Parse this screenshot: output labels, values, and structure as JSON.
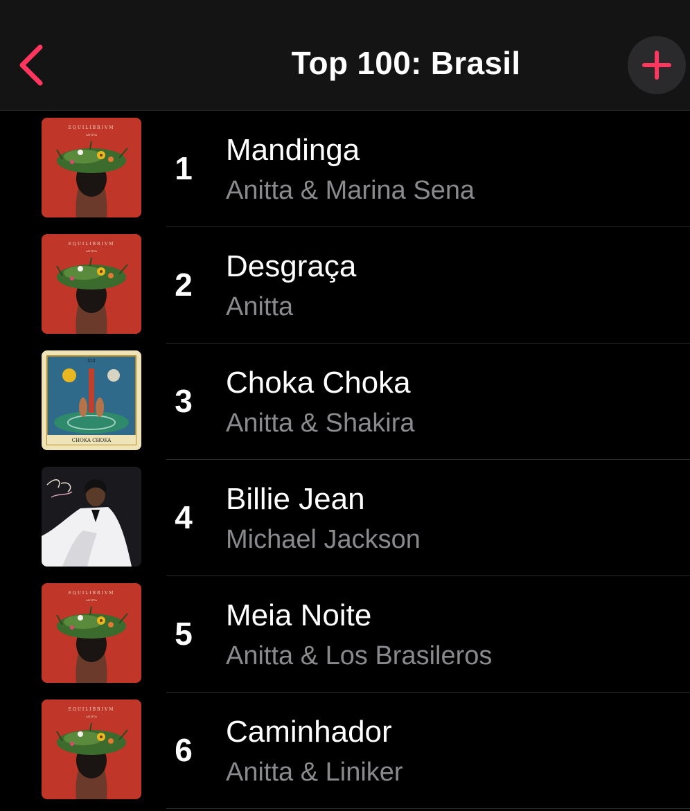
{
  "nav": {
    "title": "Top 100: Brasil",
    "accent_color": "#ff375f",
    "back_icon": "chevron-left-icon",
    "add_icon": "plus-icon"
  },
  "tracks": [
    {
      "rank": "1",
      "title": "Mandinga",
      "artist": "Anitta & Marina Sena",
      "cover": "equilibrivm"
    },
    {
      "rank": "2",
      "title": "Desgraça",
      "artist": "Anitta",
      "cover": "equilibrivm"
    },
    {
      "rank": "3",
      "title": "Choka Choka",
      "artist": "Anitta & Shakira",
      "cover": "choka-choka"
    },
    {
      "rank": "4",
      "title": "Billie Jean",
      "artist": "Michael Jackson",
      "cover": "thriller"
    },
    {
      "rank": "5",
      "title": "Meia Noite",
      "artist": "Anitta & Los Brasileros",
      "cover": "equilibrivm"
    },
    {
      "rank": "6",
      "title": "Caminhador",
      "artist": "Anitta & Liniker",
      "cover": "equilibrivm"
    }
  ]
}
